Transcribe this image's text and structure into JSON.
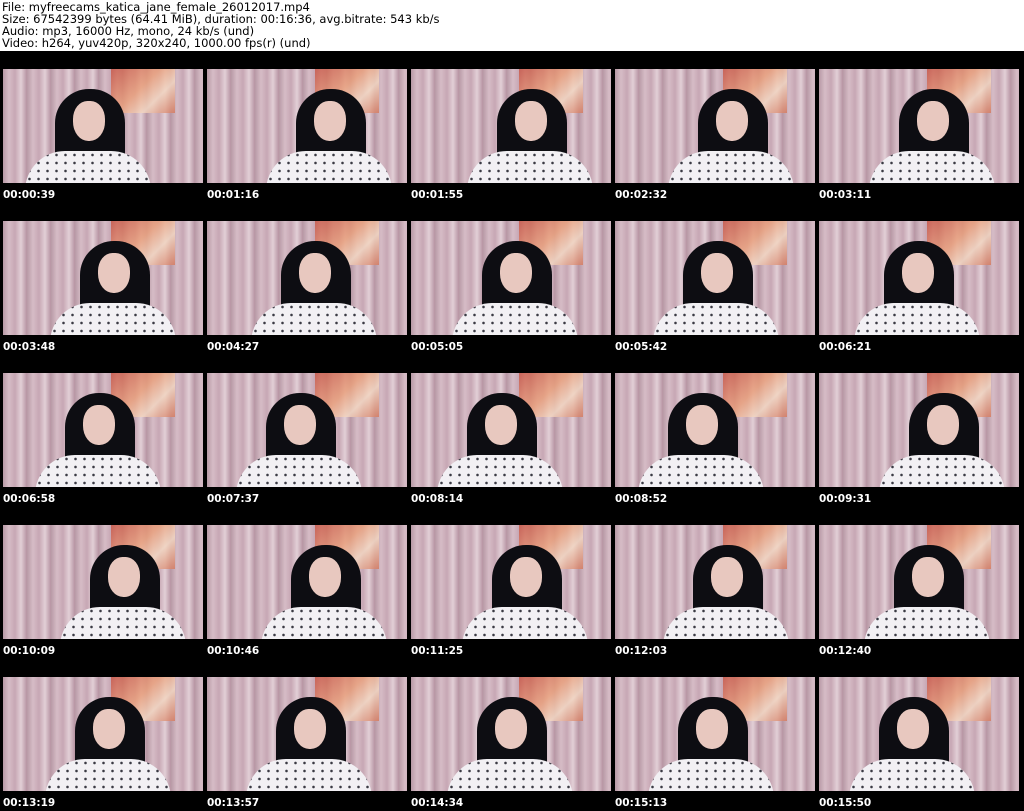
{
  "header": {
    "file": "File: myfreecams_katica_jane_female_26012017.mp4",
    "size": "Size: 67542399 bytes (64.41 MiB), duration: 00:16:36, avg.bitrate: 543 kb/s",
    "audio": "Audio: mp3, 16000 Hz, mono, 24 kb/s (und)",
    "video": "Video: h264, yuv420p, 320x240, 1000.00 fps(r) (und)"
  },
  "thumbnails": [
    {
      "time": "00:00:39"
    },
    {
      "time": "00:01:16"
    },
    {
      "time": "00:01:55"
    },
    {
      "time": "00:02:32"
    },
    {
      "time": "00:03:11"
    },
    {
      "time": "00:03:48"
    },
    {
      "time": "00:04:27"
    },
    {
      "time": "00:05:05"
    },
    {
      "time": "00:05:42"
    },
    {
      "time": "00:06:21"
    },
    {
      "time": "00:06:58"
    },
    {
      "time": "00:07:37"
    },
    {
      "time": "00:08:14"
    },
    {
      "time": "00:08:52"
    },
    {
      "time": "00:09:31"
    },
    {
      "time": "00:10:09"
    },
    {
      "time": "00:10:46"
    },
    {
      "time": "00:11:25"
    },
    {
      "time": "00:12:03"
    },
    {
      "time": "00:12:40"
    },
    {
      "time": "00:13:19"
    },
    {
      "time": "00:13:57"
    },
    {
      "time": "00:14:34"
    },
    {
      "time": "00:15:13"
    },
    {
      "time": "00:15:50"
    }
  ],
  "colors": {
    "background": "#000000",
    "header_background": "#ffffff",
    "timestamp_text": "#ffffff"
  }
}
